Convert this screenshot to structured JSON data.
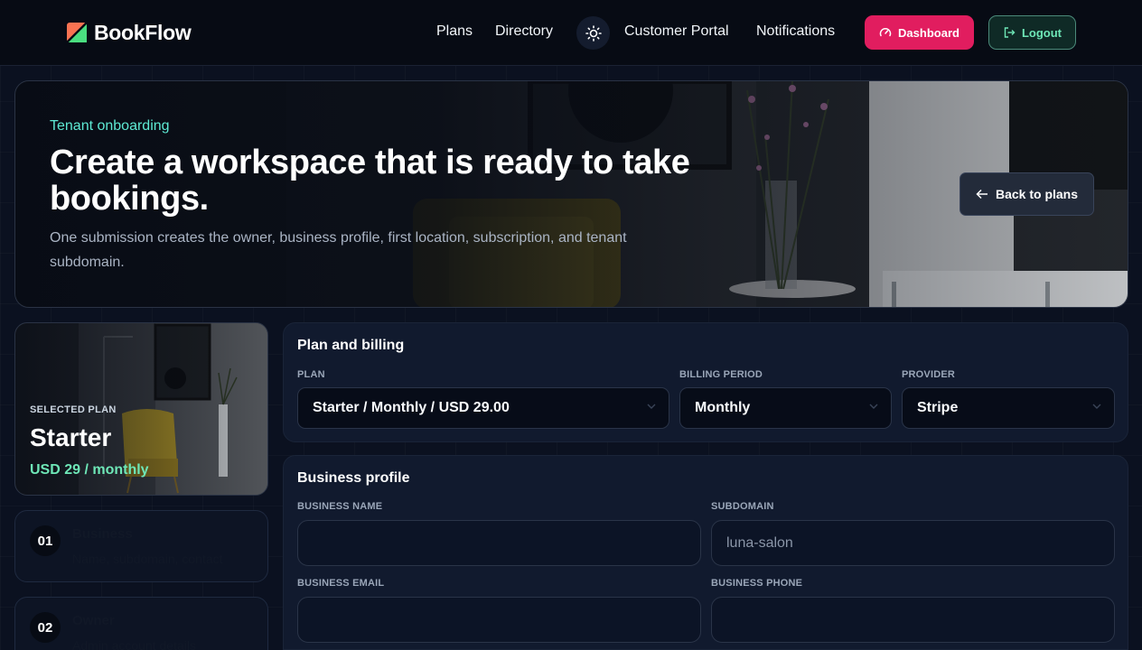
{
  "nav": {
    "brand": "BookFlow",
    "links": [
      "Plans",
      "Directory",
      "Customer Portal",
      "Notifications"
    ],
    "dashboard_label": "Dashboard",
    "logout_label": "Logout"
  },
  "hero": {
    "eyebrow": "Tenant onboarding",
    "title": "Create a workspace that is ready to take bookings.",
    "description": "One submission creates the owner, business profile, first location, subscription, and tenant subdomain.",
    "back_label": "Back to plans"
  },
  "selected_plan": {
    "eyebrow": "SELECTED PLAN",
    "name": "Starter",
    "price": "USD 29 / monthly"
  },
  "steps": [
    {
      "number": "01",
      "title": "Business",
      "subtitle": "Name, subdomain, contact"
    },
    {
      "number": "02",
      "title": "Owner",
      "subtitle": "Admin account details"
    }
  ],
  "plan_billing": {
    "title": "Plan and billing",
    "plan_label": "PLAN",
    "plan_value": "Starter / Monthly / USD 29.00",
    "period_label": "BILLING PERIOD",
    "period_value": "Monthly",
    "provider_label": "PROVIDER",
    "provider_value": "Stripe"
  },
  "business_profile": {
    "title": "Business profile",
    "name_label": "BUSINESS NAME",
    "name_value": "",
    "subdomain_label": "SUBDOMAIN",
    "subdomain_placeholder": "luna-salon",
    "email_label": "BUSINESS EMAIL",
    "email_value": "",
    "phone_label": "BUSINESS PHONE",
    "phone_value": ""
  },
  "colors": {
    "accent_pink": "#e11d5f",
    "accent_teal": "#5eead4",
    "price_green": "#6ee7b7",
    "background": "#0b1120"
  },
  "icons": [
    "brand-logo-icon",
    "sun-icon",
    "gauge-icon",
    "logout-icon",
    "arrow-left-icon",
    "chevron-down-icon"
  ]
}
